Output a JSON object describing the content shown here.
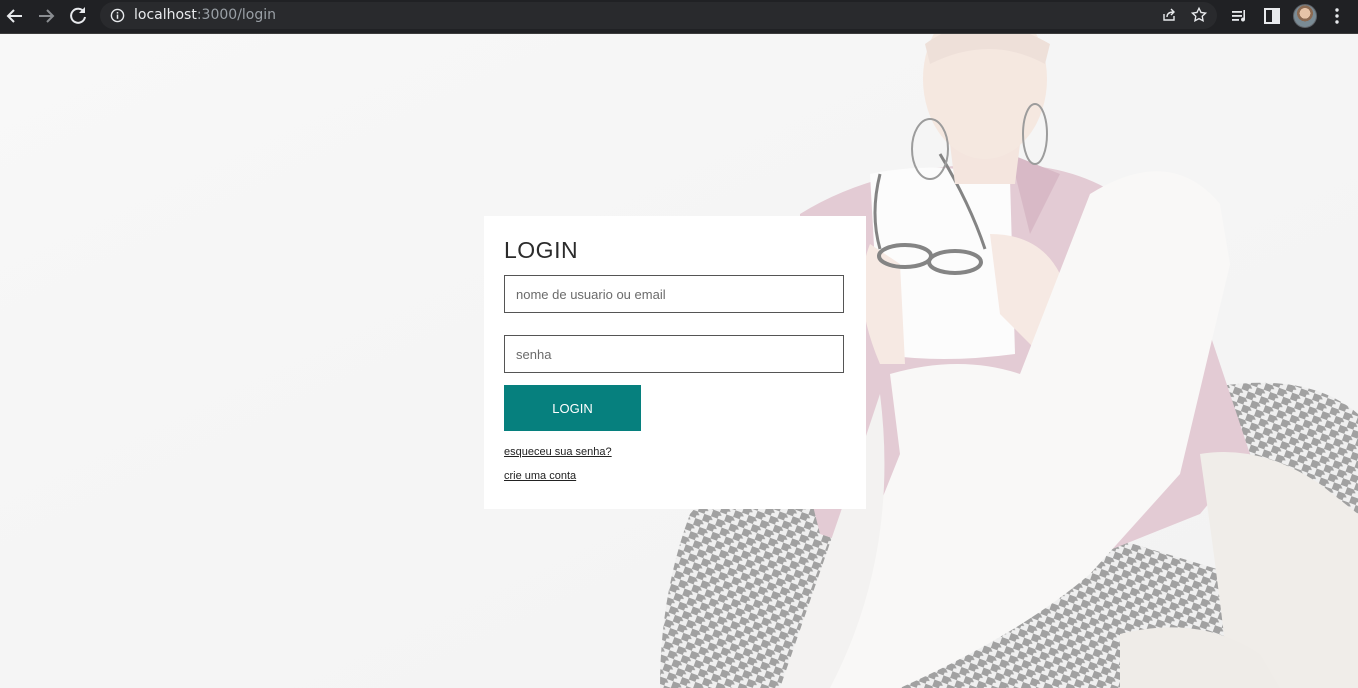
{
  "browser": {
    "url_host": "localhost",
    "url_path": ":3000/login",
    "icons": [
      "back-arrow-icon",
      "forward-arrow-icon",
      "reload-icon",
      "site-info-icon",
      "share-icon",
      "bookmark-star-icon",
      "media-controls-icon",
      "side-panel-icon",
      "profile-avatar",
      "more-menu-icon"
    ]
  },
  "login": {
    "title": "LOGIN",
    "username_placeholder": "nome de usuario ou email",
    "password_placeholder": "senha",
    "submit_label": "LOGIN",
    "forgot_link": "esqueceu sua senha?",
    "signup_link": "crie uma conta"
  },
  "colors": {
    "accent": "#06807e",
    "card": "#ffffff",
    "chrome": "#202124"
  }
}
